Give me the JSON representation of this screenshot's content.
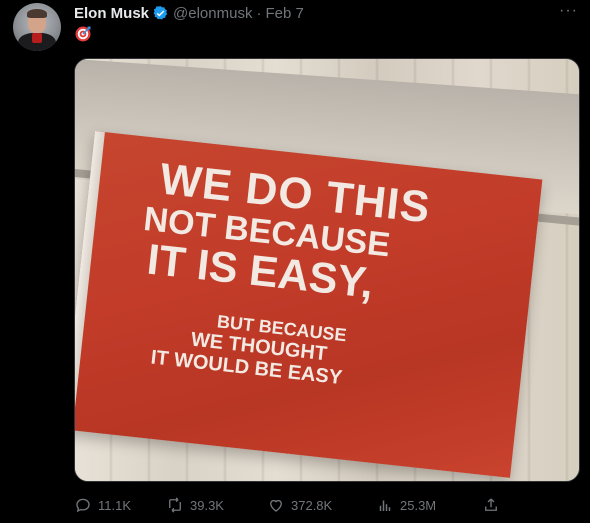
{
  "tweet": {
    "author": {
      "name": "Elon Musk",
      "handle": "@elonmusk",
      "dot": "·",
      "date": "Feb 7"
    },
    "more_label": "···",
    "text_icon": "target-emoji",
    "media": {
      "flag_lines": [
        "WE DO THIS",
        "NOT BECAUSE",
        "IT IS EASY,",
        "BUT BECAUSE",
        "WE THOUGHT",
        "IT WOULD BE EASY"
      ]
    },
    "stats": {
      "replies": "11.1K",
      "reposts": "39.3K",
      "likes": "372.8K",
      "views": "25.3M"
    },
    "colors": {
      "background": "#000000",
      "text_primary": "#e7e9ea",
      "text_secondary": "#71767b",
      "verified": "#1d9bf0",
      "flag": "#c23c29"
    },
    "icons": [
      "reply-icon",
      "retweet-icon",
      "like-icon",
      "views-icon",
      "share-icon",
      "verified-icon",
      "more-icon"
    ]
  }
}
